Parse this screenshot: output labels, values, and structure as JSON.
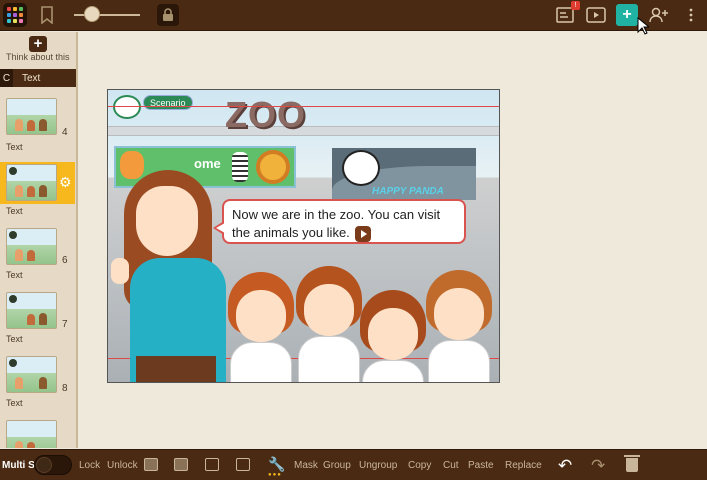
{
  "toolbar": {
    "app_colors": [
      "#e94b4b",
      "#f5b82e",
      "#5bbf62",
      "#3a9de0",
      "#a561d6",
      "#f28a3c",
      "#36c3c9",
      "#e3e35b",
      "#f07cb3"
    ],
    "notification_badge": "!",
    "add_page_symbol": "+",
    "accent": "#20b3a4"
  },
  "sidebar": {
    "add_symbol": "+",
    "preview_text": "Think about this",
    "tab_short": "C",
    "tab_label": "Text",
    "slides": [
      {
        "number": "4",
        "label": "Text"
      },
      {
        "number": "",
        "label": "Text",
        "selected": true
      },
      {
        "number": "6",
        "label": "Text"
      },
      {
        "number": "7",
        "label": "Text"
      },
      {
        "number": "8",
        "label": "Text"
      }
    ],
    "selected_color": "#f6b81c"
  },
  "slide": {
    "scenario_label": "Scenario",
    "zoo_sign": "ZOO",
    "welcome_text": "ome",
    "panda_text": "HAPPY PANDA",
    "speech": "Now we are in the zoo.  You can visit the animals you like."
  },
  "bottombar": {
    "multi_label": "Multi S",
    "lock": "Lock",
    "unlock": "Unlock",
    "mask": "Mask",
    "group": "Group",
    "ungroup": "Ungroup",
    "copy": "Copy",
    "cut": "Cut",
    "paste": "Paste",
    "replace": "Replace"
  }
}
